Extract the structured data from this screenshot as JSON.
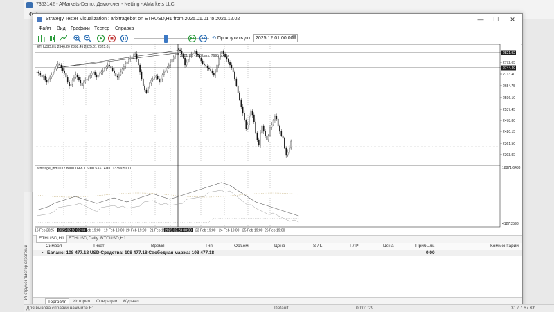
{
  "terminal": {
    "title": "7353142 - AMarkets-Demo: Демо-счет - Netting - AMarkets LLC",
    "menu_first": "Фай"
  },
  "tester": {
    "title": "Strategy Tester Visualization : arbitragebot on ETHUSD,H1 from 2025.01.01 to 2025.12.02",
    "window_buttons": [
      "—",
      "☐",
      "✕"
    ],
    "menu": [
      "Файл",
      "Вид",
      "Графики",
      "Тестер",
      "Справка"
    ],
    "toolbar": {
      "scroll_label": "Прокрутить до",
      "date_value": "2025.12.01 00:00"
    }
  },
  "chart": {
    "info_line": "ETHUSD,H1  2346.20 2358.45 2325.01 2325.01",
    "ruler_label": "2821.92 · 218 bars, 7695 points",
    "price_labels": [
      "2821.92",
      "2772.05",
      "2744.40",
      "2713.40",
      "2654.75",
      "2596.10",
      "2537.45",
      "2478.80",
      "2420.15",
      "2361.50",
      "2302.85"
    ],
    "indicator_label": "arbitrage_ind 0112.8000 1668.1.6000 5337.4000 13399.5000",
    "indicator_labels": [
      "18871.6438",
      "4127.3598"
    ],
    "time_labels": [
      "16 Feb 2025",
      "2025.02.18 02:00",
      "18 Feb 19:00",
      "19 Feb 19:00",
      "20 Feb 19:00",
      "21 Feb 19:00",
      "2025.02.23 00:00",
      "23 Feb 19:00",
      "24 Feb 19:00",
      "25 Feb 19:00",
      "26 Feb 19:00"
    ]
  },
  "chart_tabs": [
    "ETHUSD,H1",
    "ETHUSD,Daily",
    "BTCUSD,H1"
  ],
  "grid": {
    "headers": [
      "Символ",
      "Тикет",
      "Время",
      "Тип",
      "Объем",
      "Цена",
      "S / L",
      "T / P",
      "Цена",
      "Прибыль",
      "Комментарий"
    ],
    "balance_text": "Баланс: 108 477.18 USD  Средства: 108 477.18  Свободная маржа: 108 477.18",
    "profit": "0.00"
  },
  "bottom_tabs": [
    "Торговля",
    "История",
    "Операции",
    "Журнал"
  ],
  "left_strip": [
    "Тестер стратегий",
    "Инструменты"
  ],
  "status": {
    "help": "Для вызова справки нажмите F1",
    "profile": "Default",
    "time": "00:01:29",
    "traffic": "31 / 7.67 Kb"
  },
  "colors": {
    "candle": "#111111",
    "equity_line": "#555555",
    "indicator_dots": "#b8a060",
    "accent_blue": "#3b78c4",
    "active_time_bg": "#1f1f1f"
  }
}
